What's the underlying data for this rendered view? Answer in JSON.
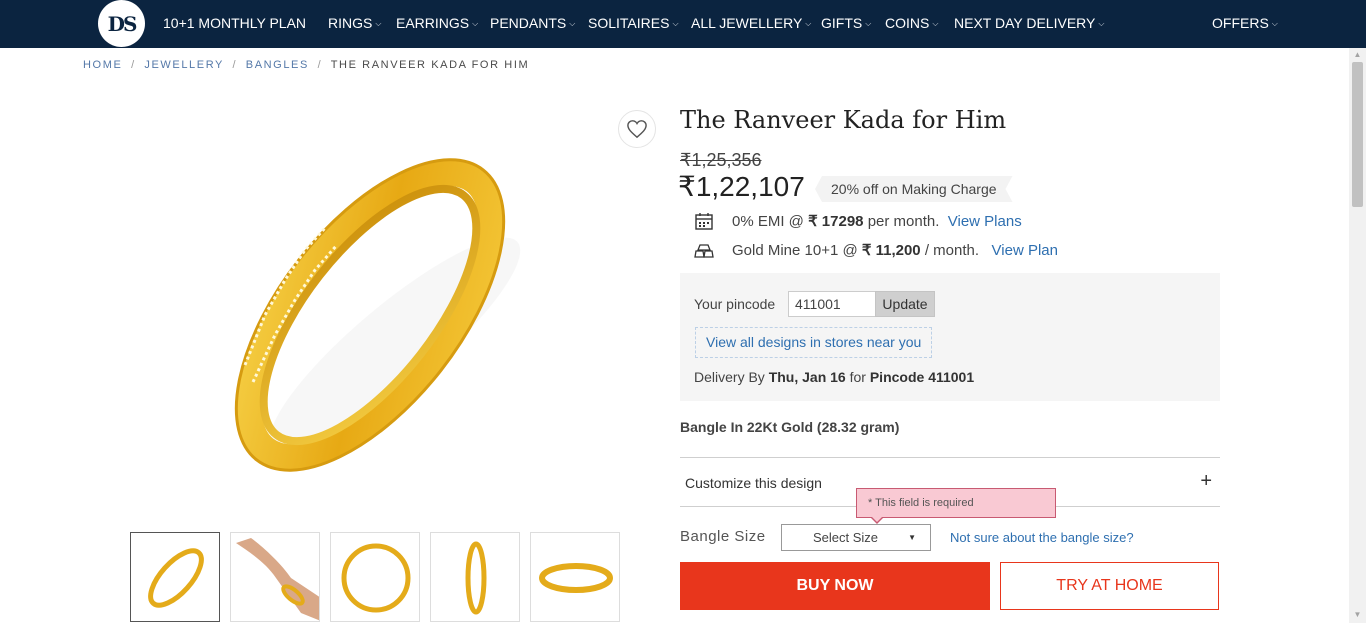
{
  "nav": {
    "logo_text": "DS",
    "items": [
      {
        "label": "10+1 MONTHLY PLAN",
        "has_dropdown": false
      },
      {
        "label": "RINGS",
        "has_dropdown": true
      },
      {
        "label": "EARRINGS",
        "has_dropdown": true
      },
      {
        "label": "PENDANTS",
        "has_dropdown": true
      },
      {
        "label": "SOLITAIRES",
        "has_dropdown": true
      },
      {
        "label": "ALL JEWELLERY",
        "has_dropdown": true
      },
      {
        "label": "GIFTS",
        "has_dropdown": true
      },
      {
        "label": "COINS",
        "has_dropdown": true
      },
      {
        "label": "NEXT DAY DELIVERY",
        "has_dropdown": true
      },
      {
        "label": "OFFERS",
        "has_dropdown": true
      }
    ]
  },
  "breadcrumb": {
    "items": [
      "HOME",
      "JEWELLERY",
      "BANGLES"
    ],
    "current": "THE RANVEER KADA FOR HIM",
    "separator": "/"
  },
  "gallery": {
    "wishlist_icon": "heart-icon",
    "thumbnails": [
      "bangle-angle",
      "bangle-on-wrist",
      "bangle-top",
      "bangle-side",
      "bangle-flat"
    ],
    "active_index": 0
  },
  "product": {
    "title": "The Ranveer Kada for Him",
    "mrp": "₹1,25,356",
    "price": "₹1,22,107",
    "offer": "20% off on Making Charge",
    "emi": {
      "prefix": "0% EMI @",
      "amount": "₹ 17298",
      "suffix": "per month.",
      "link": "View Plans"
    },
    "goldmine": {
      "prefix": "Gold Mine 10+1 @",
      "amount": "₹ 11,200",
      "suffix": "/ month.",
      "link": "View Plan"
    },
    "metal": "Bangle In 22Kt Gold (28.32 gram)"
  },
  "pincode": {
    "label": "Your pincode",
    "value": "411001",
    "update_label": "Update",
    "stores_link": "View all designs in stores near you",
    "delivery_prefix": "Delivery By",
    "delivery_date": "Thu, Jan 16",
    "delivery_mid": "for",
    "delivery_pin": "Pincode 411001"
  },
  "customize": {
    "label": "Customize this design",
    "toggle": "+"
  },
  "size": {
    "label": "Bangle Size",
    "selected": "Select Size",
    "error": "* This field is required",
    "help_link": "Not sure about the bangle size?"
  },
  "actions": {
    "buy_now": "BUY NOW",
    "try_at_home": "TRY AT HOME"
  },
  "colors": {
    "nav_bg": "#0b2440",
    "accent": "#e8361c",
    "link": "#2e6fb0",
    "gold": "#e8b320"
  }
}
